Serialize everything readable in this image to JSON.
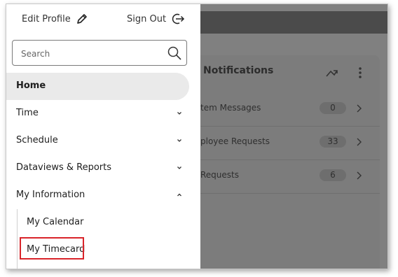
{
  "header": {
    "edit_profile": "Edit Profile",
    "sign_out": "Sign Out"
  },
  "search": {
    "placeholder": "Search",
    "value": ""
  },
  "nav": {
    "home": "Home",
    "time": "Time",
    "schedule": "Schedule",
    "dataviews": "Dataviews & Reports",
    "my_information": "My Information",
    "my_calendar": "My Calendar",
    "my_timecard": "My Timecard"
  },
  "notifications": {
    "title": "Notifications",
    "rows": [
      {
        "label": "tem Messages",
        "count": "0"
      },
      {
        "label": "ployee Requests",
        "count": "33"
      },
      {
        "label": "Requests",
        "count": "6"
      }
    ]
  },
  "colors": {
    "highlight": "#d9242a",
    "active_bg": "#eaeaea",
    "overlay": "#808080"
  },
  "icons": [
    "pencil-icon",
    "sign-out-icon",
    "search-icon",
    "chevron-down-icon",
    "chevron-up-icon",
    "share-icon",
    "more-vertical-icon",
    "chevron-right-icon"
  ]
}
